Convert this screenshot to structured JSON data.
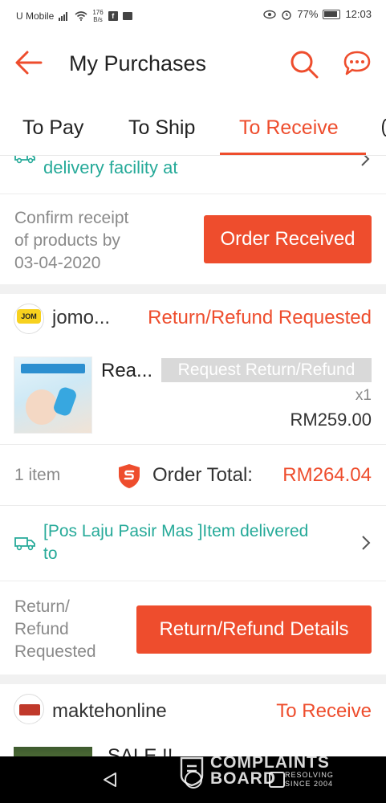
{
  "status_bar": {
    "carrier": "U Mobile",
    "net_speed_value": "176",
    "net_speed_unit": "B/s",
    "battery": "77%",
    "time": "12:03"
  },
  "header": {
    "title": "My Purchases"
  },
  "tabs": [
    {
      "label": "To Pay",
      "active": false
    },
    {
      "label": "To Ship",
      "active": false
    },
    {
      "label": "To Receive",
      "active": true
    }
  ],
  "order1": {
    "tracking_text": "delivery facility at",
    "confirm_text_line1": "Confirm receipt",
    "confirm_text_line2": "of products by",
    "confirm_text_line3": "03-04-2020",
    "button_label": "Order Received"
  },
  "order2": {
    "shop_name": "jomo...",
    "shop_logo_text": "JOM",
    "status": "Return/Refund Requested",
    "product_name": "Rea...",
    "product_tag": "Request Return/Refund",
    "quantity": "x1",
    "price": "RM259.00",
    "item_count": "1 item",
    "order_total_label": "Order Total:",
    "order_total_value": "RM264.04",
    "tracking_line1": "[Pos Laju Pasir Mas ]Item delivered",
    "tracking_line2": "to",
    "footer_line1": "Return/",
    "footer_line2": "Refund",
    "footer_line3": "Requested",
    "button_label": "Return/Refund Details"
  },
  "order3": {
    "shop_name": "maktehonline",
    "status": "To Receive",
    "product_name_partial": "SALE !!"
  },
  "watermark": {
    "line1": "COMPLAINTS",
    "line2": "BOARD",
    "tagline1": "RESOLVING",
    "tagline2": "SINCE 2004"
  },
  "colors": {
    "accent": "#ee4d2d",
    "teal": "#26aa99",
    "grey_text": "#8a8a8a"
  }
}
